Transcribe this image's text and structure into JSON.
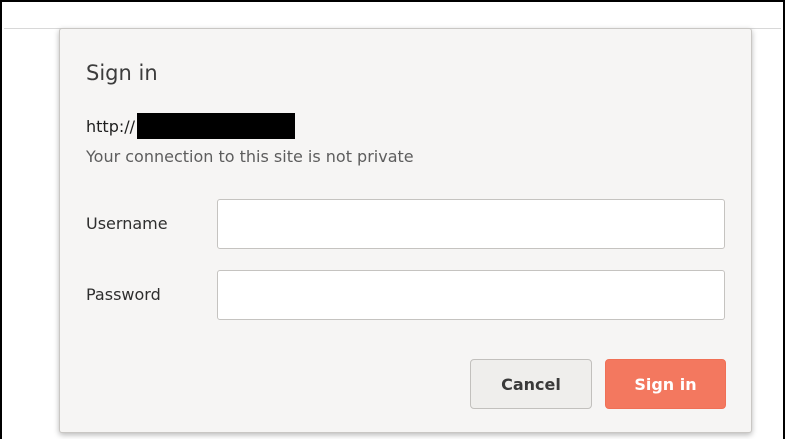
{
  "dialog": {
    "title": "Sign in",
    "url_prefix": "http://",
    "url_host_redacted": true,
    "connection_notice": "Your connection to this site is not private",
    "username": {
      "label": "Username",
      "value": "",
      "placeholder": ""
    },
    "password": {
      "label": "Password",
      "value": "",
      "placeholder": ""
    },
    "buttons": {
      "cancel_label": "Cancel",
      "signin_label": "Sign in"
    }
  },
  "colors": {
    "dialog_background": "#f6f5f4",
    "primary_button": "#f3785f",
    "secondary_button": "#efeeec",
    "redaction": "#000000"
  }
}
